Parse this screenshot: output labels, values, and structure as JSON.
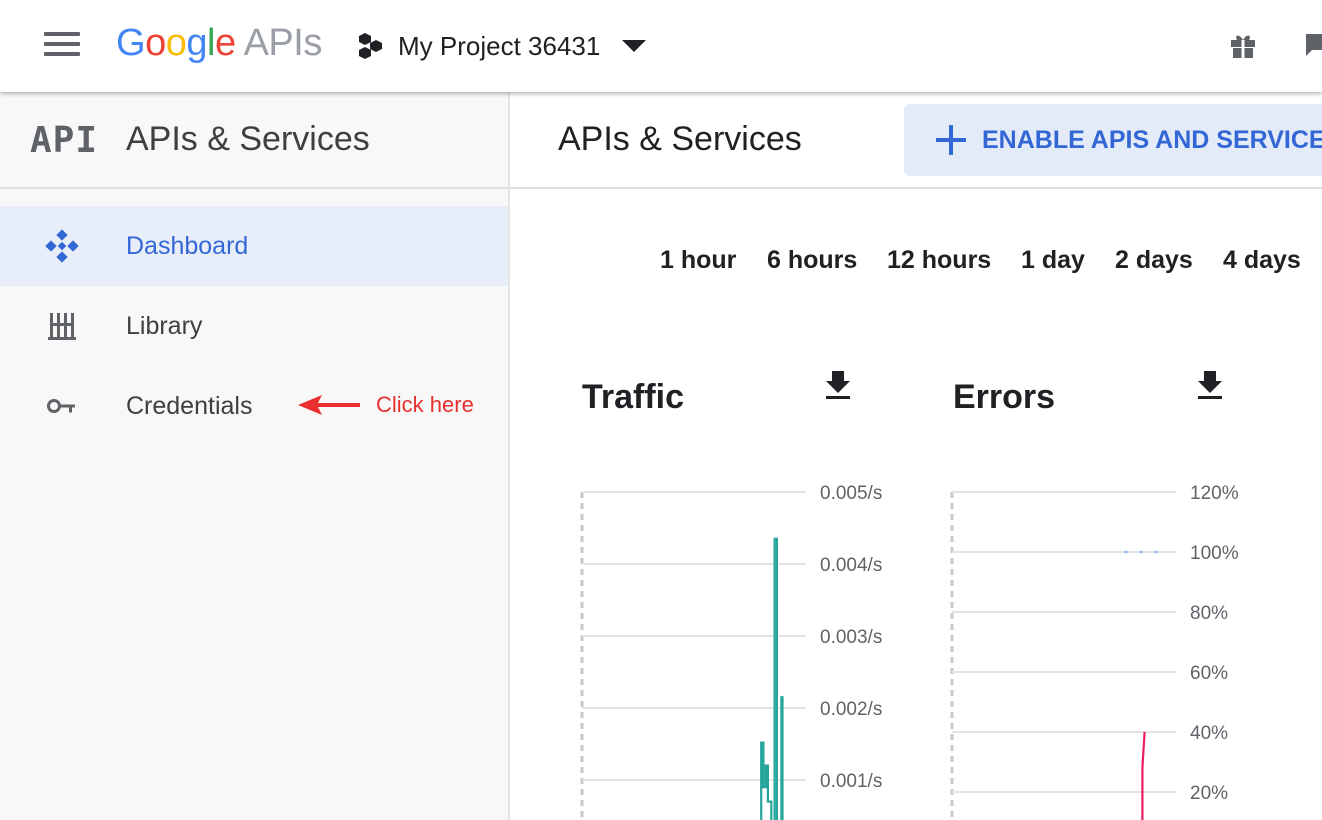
{
  "topbar": {
    "logo_google": [
      "G",
      "o",
      "o",
      "g",
      "l",
      "e"
    ],
    "logo_colors": [
      "#4285f4",
      "#ea4335",
      "#fbbc05",
      "#4285f4",
      "#34a853",
      "#ea4335"
    ],
    "logo_apis": "APIs",
    "project_name": "My Project 36431",
    "icons": [
      "menu-icon",
      "project-hexagons-icon",
      "dropdown-arrow-icon",
      "gift-icon",
      "chat-icon"
    ]
  },
  "sidebar": {
    "api_logo": "API",
    "title": "APIs & Services",
    "items": [
      {
        "label": "Dashboard",
        "icon": "dashboard-diamond-icon",
        "active": true
      },
      {
        "label": "Library",
        "icon": "library-icon",
        "active": false
      },
      {
        "label": "Credentials",
        "icon": "key-icon",
        "active": false
      }
    ],
    "hint": {
      "text": "Click here",
      "color": "#e9302f"
    }
  },
  "main": {
    "title": "APIs & Services",
    "enable_button": "ENABLE APIS AND SERVICES",
    "time_ranges": [
      "1 hour",
      "6 hours",
      "12 hours",
      "1 day",
      "2 days",
      "4 days"
    ],
    "accent_color": "#3367d6"
  },
  "chart_data": [
    {
      "type": "line",
      "title": "Traffic",
      "ylim": [
        0,
        0.005
      ],
      "y_ticks": [
        "0.005/s",
        "0.004/s",
        "0.003/s",
        "0.002/s",
        "0.001/s"
      ],
      "series": [
        {
          "color": "#26a69a",
          "points": [
            [
              0.8,
              0.0
            ],
            [
              0.8,
              0.00152
            ],
            [
              0.81,
              0.00152
            ],
            [
              0.81,
              0.0009
            ],
            [
              0.82,
              0.0009
            ],
            [
              0.82,
              0.0012
            ],
            [
              0.83,
              0.0012
            ],
            [
              0.83,
              0.0007
            ],
            [
              0.845,
              0.0007
            ],
            [
              0.845,
              0.0
            ],
            [
              0.86,
              0.0
            ],
            [
              0.86,
              0.00435
            ],
            [
              0.87,
              0.00435
            ],
            [
              0.87,
              0.0
            ],
            [
              0.88,
              0.0
            ],
            [
              0.88,
              0.0
            ],
            [
              0.89,
              0.0
            ],
            [
              0.89,
              0.00215
            ],
            [
              0.895,
              0.00215
            ],
            [
              0.895,
              0.0
            ]
          ]
        }
      ]
    },
    {
      "type": "line",
      "title": "Errors",
      "ylim": [
        0,
        120
      ],
      "y_ticks": [
        "120%",
        "100%",
        "80%",
        "60%",
        "40%",
        "20%"
      ],
      "series": [
        {
          "color": "#e91e63",
          "points": [
            [
              0.85,
              0
            ],
            [
              0.85,
              28
            ],
            [
              0.86,
              40
            ]
          ]
        },
        {
          "color": "#8ab4f8",
          "dashed": true,
          "points": [
            [
              0.77,
              100
            ],
            [
              0.8,
              100
            ],
            [
              0.95,
              100
            ]
          ]
        }
      ]
    }
  ]
}
